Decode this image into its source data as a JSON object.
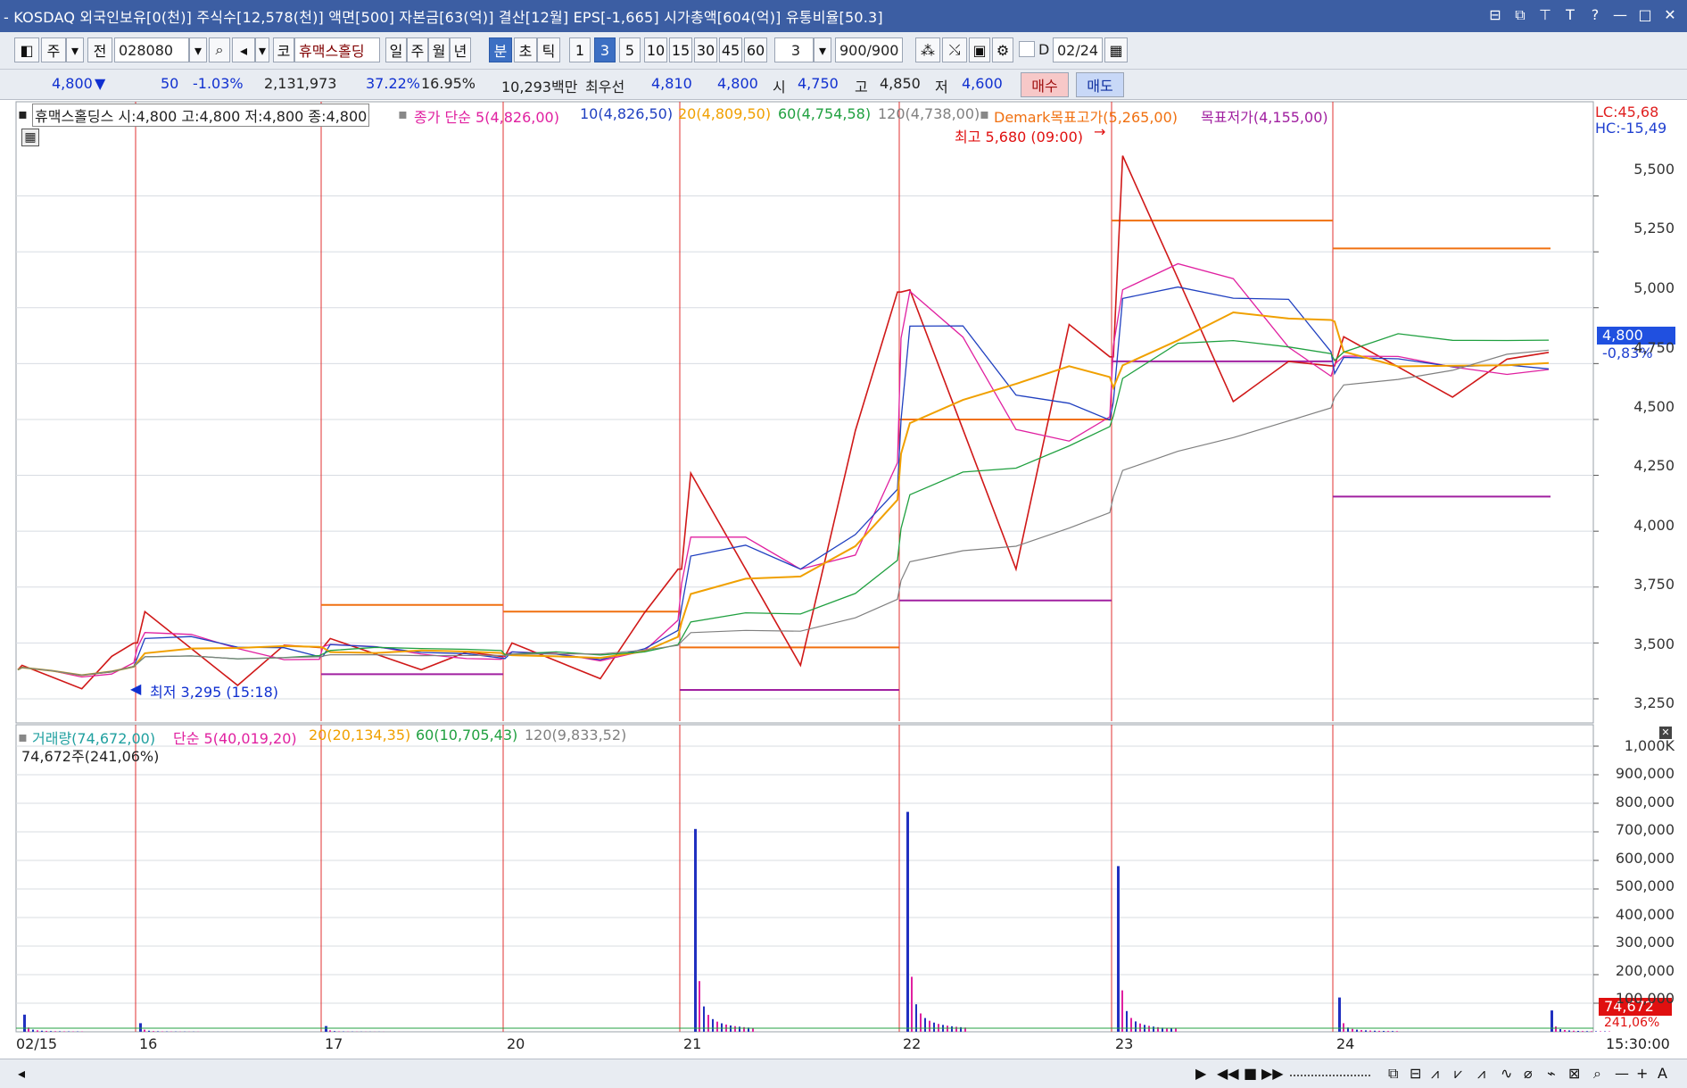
{
  "window": {
    "title": "- KOSDAQ 외국인보유[0(천)] 주식수[12,578(천)] 액면[500] 자본금[63(억)] 결산[12월] EPS[-1,665] 시가총액[604(억)] 유통비율[50.3]",
    "controls": [
      "⊟",
      "⧉",
      "⊤",
      "T",
      "?",
      "—",
      "□",
      "✕"
    ]
  },
  "toolbar": {
    "period_btn": "주",
    "prev_btn": "전",
    "code": "028080",
    "market_btn": "코",
    "stock_name": "휴맥스홀딩",
    "period_tabs": [
      "일",
      "주",
      "월",
      "년",
      "분",
      "초",
      "틱"
    ],
    "selected_period": "분",
    "minute_values": [
      "1",
      "3",
      "5",
      "10",
      "15",
      "30",
      "45",
      "60"
    ],
    "selected_minute": "3",
    "custom_minute": "3",
    "count": "900/900",
    "date_check_label": "D",
    "date": "02/24"
  },
  "quote": {
    "price": "4,800",
    "direction": "▼",
    "change": "50",
    "change_pct": "-1.03%",
    "volume": "2,131,973",
    "ratio1": "37.22%",
    "ratio2": "16.95%",
    "amount": "10,293백만",
    "best_label": "최우선",
    "ask": "4,810",
    "bid": "4,800",
    "open_label": "시",
    "open": "4,750",
    "high_label": "고",
    "high": "4,850",
    "low_label": "저",
    "low": "4,600",
    "buy_btn": "매수",
    "sell_btn": "매도"
  },
  "price_legend": {
    "ohlc": "휴맥스홀딩스 시:4,800 고:4,800 저:4,800 종:4,800",
    "ma_label": "종가 단순 5(4,826,00)",
    "ma10": "10(4,826,50)",
    "ma20": "20(4,809,50)",
    "ma60": "60(4,754,58)",
    "ma120": "120(4,738,00)",
    "demark_high": "Demark목표고가(5,265,00)",
    "demark_low": "목표저가(4,155,00)",
    "lc": "LC:45,68",
    "hc": "HC:-15,49",
    "max_note": "최고 5,680 (09:00)",
    "min_note": "최저 3,295 (15:18)",
    "current_price": "4,800",
    "current_pct": "-0,83%"
  },
  "volume_legend": {
    "vol": "거래량(74,672,00)",
    "ma5": "단순 5(40,019,20)",
    "ma20": "20(20,134,35)",
    "ma60": "60(10,705,43)",
    "ma120": "120(9,833,52)",
    "sub": "74,672주(241,06%)",
    "current": "74,672",
    "current_pct": "241,06%"
  },
  "date_labels": [
    "02/15",
    "16",
    "17",
    "20",
    "21",
    "22",
    "23",
    "24"
  ],
  "time_label": "15:30:00",
  "colors": {
    "title_bg": "#3c5ea3",
    "day_line": "#e03030",
    "ma5": "#e020a0",
    "ma10": "#2040c0",
    "ma20": "#f0a000",
    "ma60": "#20a040",
    "ma120": "#808080",
    "demark_high": "#f07010",
    "demark_low": "#a020a0"
  },
  "chart_data": {
    "type": "line",
    "price_axis": [
      "5,500",
      "5,250",
      "5,000",
      "4,750",
      "4,500",
      "4,250",
      "4,000",
      "3,750",
      "3,500",
      "3,250"
    ],
    "volume_axis": [
      "1,000K",
      "900,000",
      "800,000",
      "700,000",
      "600,000",
      "500,000",
      "400,000",
      "300,000",
      "200,000",
      "100,000"
    ],
    "ylim_price": [
      3150,
      5650
    ],
    "ylim_volume": [
      0,
      1050000
    ],
    "x": [
      "02/15 13:30",
      "02/16 09:00",
      "02/17 09:00",
      "02/20 09:00",
      "02/21 09:00",
      "02/22 09:00",
      "02/23 09:00",
      "02/24 09:00",
      "02/24 15:30"
    ],
    "close": [
      3380,
      3500,
      3480,
      3440,
      3830,
      5070,
      4780,
      4740,
      4800
    ],
    "high": [
      3400,
      3640,
      3520,
      3500,
      4260,
      5080,
      5680,
      4870,
      4850
    ],
    "low": [
      3295,
      3310,
      3380,
      3340,
      3400,
      3830,
      4580,
      4600,
      4600
    ],
    "demark_high_levels": [
      3670,
      3640,
      3480,
      4500,
      5390,
      5265
    ],
    "demark_low_levels": [
      3360,
      3290,
      3690,
      4760,
      4155
    ],
    "volume_peaks": [
      60000,
      30000,
      20000,
      710000,
      770000,
      580000,
      120000,
      74672
    ]
  }
}
